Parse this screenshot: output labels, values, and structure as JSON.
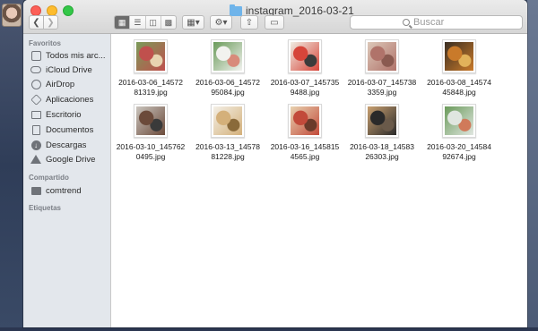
{
  "window": {
    "title": "instagram_2016-03-21"
  },
  "toolbar": {
    "back_icon": "chevron-left",
    "forward_icon": "chevron-right",
    "view_modes": [
      "icon-view",
      "list-view",
      "column-view",
      "coverflow-view"
    ],
    "active_view": "icon-view",
    "search_placeholder": "Buscar"
  },
  "sidebar": {
    "favorites_header": "Favoritos",
    "favorites": [
      {
        "label": "Todos mis arc...",
        "icon": "all-files-icon"
      },
      {
        "label": "iCloud Drive",
        "icon": "cloud-icon"
      },
      {
        "label": "AirDrop",
        "icon": "airdrop-icon"
      },
      {
        "label": "Aplicaciones",
        "icon": "applications-icon"
      },
      {
        "label": "Escritorio",
        "icon": "desktop-icon"
      },
      {
        "label": "Documentos",
        "icon": "documents-icon"
      },
      {
        "label": "Descargas",
        "icon": "downloads-icon"
      },
      {
        "label": "Google Drive",
        "icon": "google-drive-icon"
      }
    ],
    "shared_header": "Compartido",
    "shared": [
      {
        "label": "comtrend",
        "icon": "computer-icon"
      }
    ],
    "tags_header": "Etiquetas"
  },
  "files": [
    {
      "name_line1": "2016-03-06_14572",
      "name_line2": "81319.jpg",
      "colors": [
        "#c0504d",
        "#7a9a58",
        "#e8d3b0"
      ]
    },
    {
      "name_line1": "2016-03-06_14572",
      "name_line2": "95084.jpg",
      "colors": [
        "#f2f2ef",
        "#6a9b5a",
        "#d88a7a"
      ]
    },
    {
      "name_line1": "2016-03-07_145735",
      "name_line2": "9488.jpg",
      "colors": [
        "#d6453a",
        "#f0ece2",
        "#3b3b3b"
      ]
    },
    {
      "name_line1": "2016-03-07_145738",
      "name_line2": "3359.jpg",
      "colors": [
        "#b0736a",
        "#dcc7b8",
        "#8a5a50"
      ]
    },
    {
      "name_line1": "2016-03-08_14574",
      "name_line2": "45848.jpg",
      "colors": [
        "#c97a2a",
        "#3a2e22",
        "#e2b25a"
      ]
    },
    {
      "name_line1": "2016-03-10_145762",
      "name_line2": "0495.jpg",
      "colors": [
        "#6b4a3a",
        "#c9c4bd",
        "#3a3a3a"
      ]
    },
    {
      "name_line1": "2016-03-13_14578",
      "name_line2": "81228.jpg",
      "colors": [
        "#d4b07a",
        "#f3efe6",
        "#8a6a3a"
      ]
    },
    {
      "name_line1": "2016-03-16_145815",
      "name_line2": "4565.jpg",
      "colors": [
        "#c24a3a",
        "#e8d2b0",
        "#6a3a2a"
      ]
    },
    {
      "name_line1": "2016-03-18_14583",
      "name_line2": "26303.jpg",
      "colors": [
        "#2a2a2a",
        "#c9a070",
        "#6a5a4a"
      ]
    },
    {
      "name_line1": "2016-03-20_14584",
      "name_line2": "92674.jpg",
      "colors": [
        "#e0e6e0",
        "#6a9a5a",
        "#d07a5a"
      ]
    }
  ]
}
